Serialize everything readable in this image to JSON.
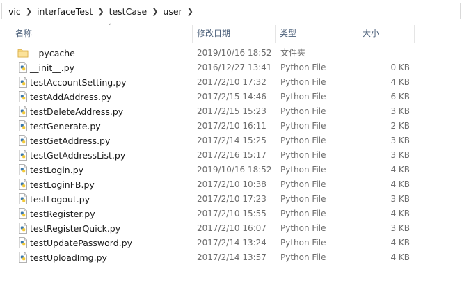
{
  "breadcrumb": [
    "vic",
    "interfaceTest",
    "testCase",
    "user"
  ],
  "columns": {
    "name": "名称",
    "date": "修改日期",
    "type": "类型",
    "size": "大小"
  },
  "files": [
    {
      "name": "__pycache__",
      "date": "2019/10/16 18:52",
      "type": "文件夹",
      "size": "",
      "icon": "folder-icon"
    },
    {
      "name": "__init__.py",
      "date": "2016/12/27 13:41",
      "type": "Python File",
      "size": "0 KB",
      "icon": "python-file-icon"
    },
    {
      "name": "testAccountSetting.py",
      "date": "2017/2/10 17:32",
      "type": "Python File",
      "size": "4 KB",
      "icon": "python-file-icon"
    },
    {
      "name": "testAddAddress.py",
      "date": "2017/2/15 14:46",
      "type": "Python File",
      "size": "6 KB",
      "icon": "python-file-icon"
    },
    {
      "name": "testDeleteAddress.py",
      "date": "2017/2/15 15:23",
      "type": "Python File",
      "size": "3 KB",
      "icon": "python-file-icon"
    },
    {
      "name": "testGenerate.py",
      "date": "2017/2/10 16:11",
      "type": "Python File",
      "size": "2 KB",
      "icon": "python-file-icon"
    },
    {
      "name": "testGetAddress.py",
      "date": "2017/2/14 15:25",
      "type": "Python File",
      "size": "3 KB",
      "icon": "python-file-icon"
    },
    {
      "name": "testGetAddressList.py",
      "date": "2017/2/16 15:17",
      "type": "Python File",
      "size": "3 KB",
      "icon": "python-file-icon"
    },
    {
      "name": "testLogin.py",
      "date": "2019/10/16 18:52",
      "type": "Python File",
      "size": "4 KB",
      "icon": "python-file-icon"
    },
    {
      "name": "testLoginFB.py",
      "date": "2017/2/10 10:38",
      "type": "Python File",
      "size": "4 KB",
      "icon": "python-file-icon"
    },
    {
      "name": "testLogout.py",
      "date": "2017/2/10 17:23",
      "type": "Python File",
      "size": "3 KB",
      "icon": "python-file-icon"
    },
    {
      "name": "testRegister.py",
      "date": "2017/2/10 15:55",
      "type": "Python File",
      "size": "4 KB",
      "icon": "python-file-icon"
    },
    {
      "name": "testRegisterQuick.py",
      "date": "2017/2/10 16:07",
      "type": "Python File",
      "size": "3 KB",
      "icon": "python-file-icon"
    },
    {
      "name": "testUpdatePassword.py",
      "date": "2017/2/14 13:24",
      "type": "Python File",
      "size": "4 KB",
      "icon": "python-file-icon"
    },
    {
      "name": "testUploadImg.py",
      "date": "2017/2/14 13:57",
      "type": "Python File",
      "size": "4 KB",
      "icon": "python-file-icon"
    }
  ],
  "colors": {
    "header_text": "#4c607a",
    "secondary_text": "#6d6d6d",
    "folder": "#f8d775",
    "python_blue": "#3b77a8",
    "python_yellow": "#f3c938"
  }
}
